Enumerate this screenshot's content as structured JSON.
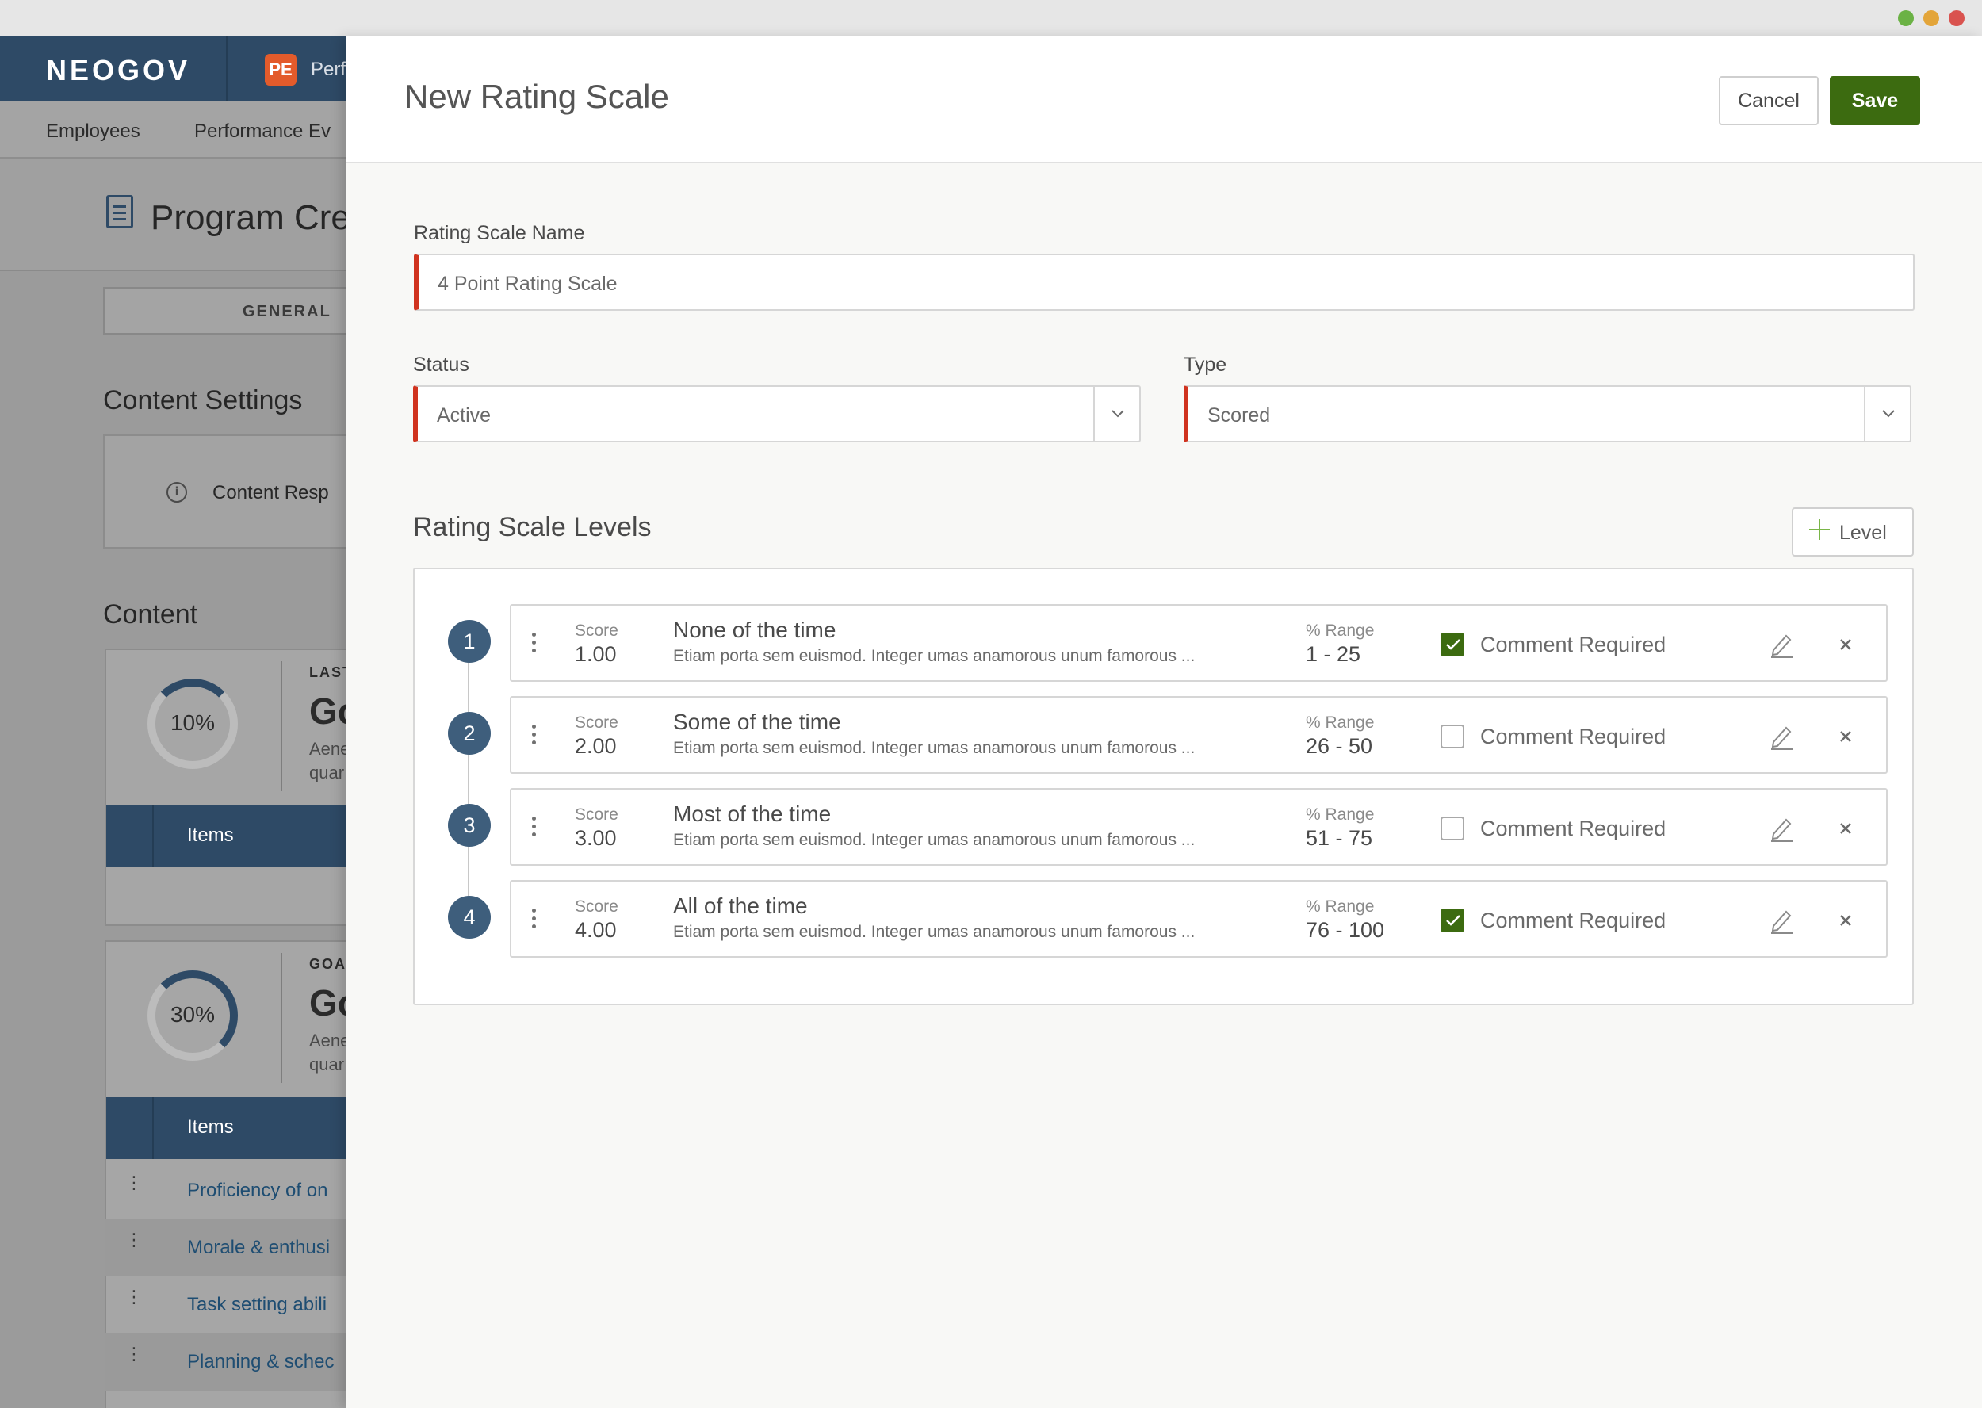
{
  "background_app": {
    "logo": "NEOGOV",
    "product_badge": "PE",
    "product_name": "Perf",
    "nav": [
      "Employees",
      "Performance Ev"
    ],
    "page_title": "Program Cre",
    "tab_label": "GENERAL",
    "content_settings_title": "Content Settings",
    "content_settings_info": "Content Resp",
    "content_title": "Content",
    "cards": [
      {
        "percent": "10%",
        "label": "LAST",
        "title": "Go",
        "desc_line1": "Aene",
        "desc_line2": "quar",
        "items_label": "Items"
      },
      {
        "percent": "30%",
        "label": "GOA",
        "title": "Go",
        "desc_line1": "Aene",
        "desc_line2": "quar",
        "items_label": "Items"
      }
    ],
    "item_rows": [
      "Proficiency of on",
      "Morale & enthusi",
      "Task setting abili",
      "Planning & schec"
    ]
  },
  "modal": {
    "title": "New Rating Scale",
    "cancel_label": "Cancel",
    "save_label": "Save",
    "name_label": "Rating Scale Name",
    "name_value": "4 Point Rating Scale",
    "status_label": "Status",
    "status_value": "Active",
    "type_label": "Type",
    "type_value": "Scored",
    "levels_title": "Rating Scale Levels",
    "add_level_label": "Level",
    "score_label": "Score",
    "range_label": "% Range",
    "comment_label": "Comment Required",
    "levels": [
      {
        "num": "1",
        "score": "1.00",
        "name": "None of the time",
        "desc": "Etiam porta sem euismod. Integer umas anamorous unum famorous ...",
        "range": "1 - 25",
        "comment_required": true
      },
      {
        "num": "2",
        "score": "2.00",
        "name": "Some of the time",
        "desc": "Etiam porta sem euismod. Integer umas anamorous unum famorous ...",
        "range": "26 - 50",
        "comment_required": false
      },
      {
        "num": "3",
        "score": "3.00",
        "name": "Most of the time",
        "desc": "Etiam porta sem euismod. Integer umas anamorous unum famorous ...",
        "range": "51 - 75",
        "comment_required": false
      },
      {
        "num": "4",
        "score": "4.00",
        "name": "All of the time",
        "desc": "Etiam porta sem euismod. Integer umas anamorous unum famorous ...",
        "range": "76 - 100",
        "comment_required": true
      }
    ]
  },
  "colors": {
    "brand_navy": "#2e4a66",
    "save_green": "#3c6b10",
    "required_red": "#d0331f",
    "badge_blue": "#3e5e7c"
  }
}
